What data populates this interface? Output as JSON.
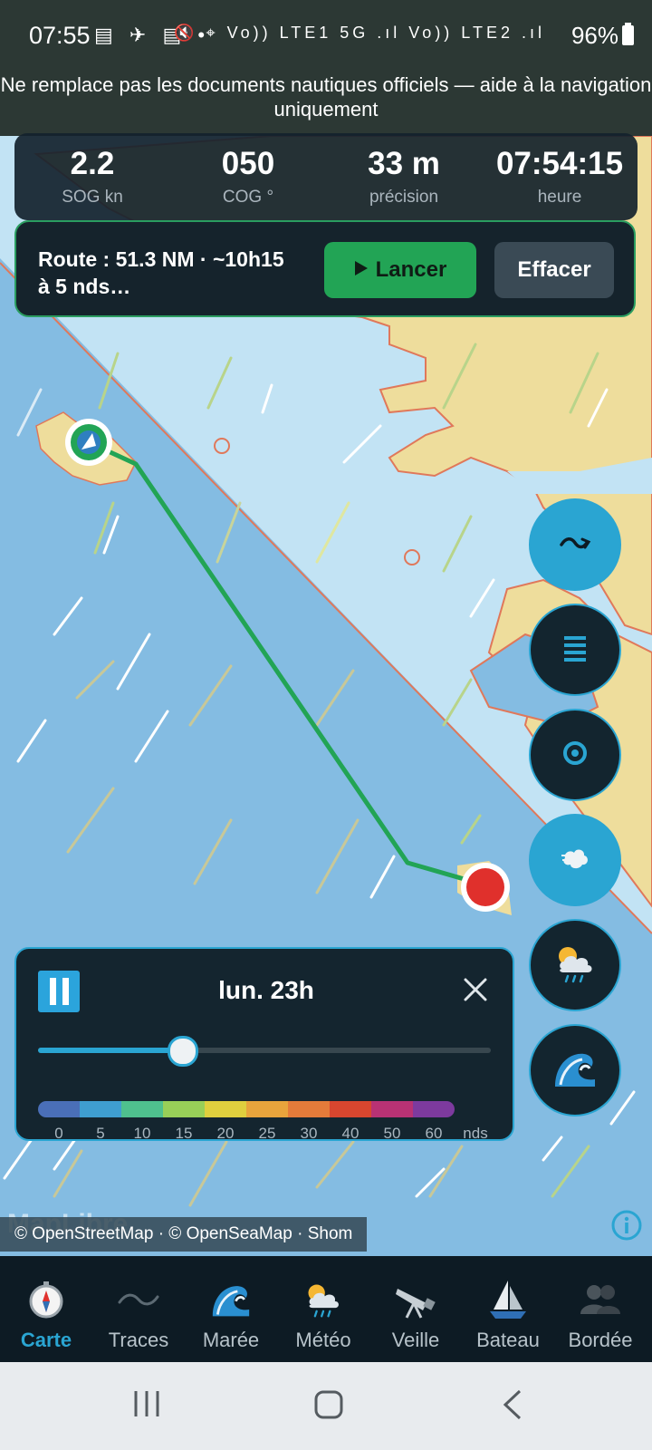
{
  "status_bar": {
    "time": "07:55",
    "left_icons": "▤ ✈ ▤ •",
    "right_icons": "🔇 ⌖ Vo)) LTE1 5G .ıl Vo)) LTE2 .ıl",
    "battery": "96%"
  },
  "disclaimer": "Ne remplace pas les documents nautiques officiels — aide à la navigation uniquement",
  "stats": [
    {
      "value": "2.2",
      "label": "SOG kn"
    },
    {
      "value": "050",
      "label": "COG °"
    },
    {
      "value": "33 m",
      "label": "précision"
    },
    {
      "value": "07:54:15",
      "label": "heure"
    }
  ],
  "route": {
    "summary": "Route : 51.3 NM · ~10h15 à 5 nds…",
    "launch_label": "Lancer",
    "launch_icon": "play-icon",
    "clear_label": "Effacer"
  },
  "fabs": [
    {
      "name": "route-mode-button",
      "icon": "route-arrow-icon",
      "style": "blue"
    },
    {
      "name": "layers-button",
      "icon": "layers-icon",
      "style": "dark"
    },
    {
      "name": "center-location-button",
      "icon": "target-icon",
      "style": "dark"
    },
    {
      "name": "wind-layer-button",
      "icon": "wind-icon",
      "style": "blue"
    },
    {
      "name": "weather-layer-button",
      "icon": "rain-cloud-icon",
      "style": "dark"
    },
    {
      "name": "wave-layer-button",
      "icon": "wave-icon",
      "style": "dark"
    }
  ],
  "timeline": {
    "time_label": "lun. 23h",
    "slider_fraction": 0.32,
    "scale_colors": [
      "#4a6fb8",
      "#3f9ed0",
      "#4fc08e",
      "#98cf58",
      "#dfcf3e",
      "#e8a43c",
      "#e47b3a",
      "#d8462f",
      "#b83274",
      "#7d3a9e"
    ],
    "scale_labels": [
      "0",
      "5",
      "10",
      "15",
      "20",
      "25",
      "30",
      "40",
      "50",
      "60",
      "nds"
    ]
  },
  "attribution": "© OpenStreetMap · © OpenSeaMap · Shom",
  "maplibre_logo": "MapLibre",
  "tabs": [
    {
      "label": "Carte",
      "icon": "compass-icon",
      "active": true
    },
    {
      "label": "Traces",
      "icon": "tilde-icon",
      "active": false
    },
    {
      "label": "Marée",
      "icon": "wave-icon",
      "active": false
    },
    {
      "label": "Météo",
      "icon": "sun-rain-icon",
      "active": false
    },
    {
      "label": "Veille",
      "icon": "telescope-icon",
      "active": false
    },
    {
      "label": "Bateau",
      "icon": "sailboat-icon",
      "active": false
    },
    {
      "label": "Bordée",
      "icon": "crew-icon",
      "active": false
    }
  ],
  "colors": {
    "accent": "#2aa5d2",
    "route_green": "#22a455",
    "sea_deep": "#84bce2",
    "sea_shallow": "#c2e3f4",
    "land": "#eedd9c",
    "coastline": "#e0785a"
  }
}
